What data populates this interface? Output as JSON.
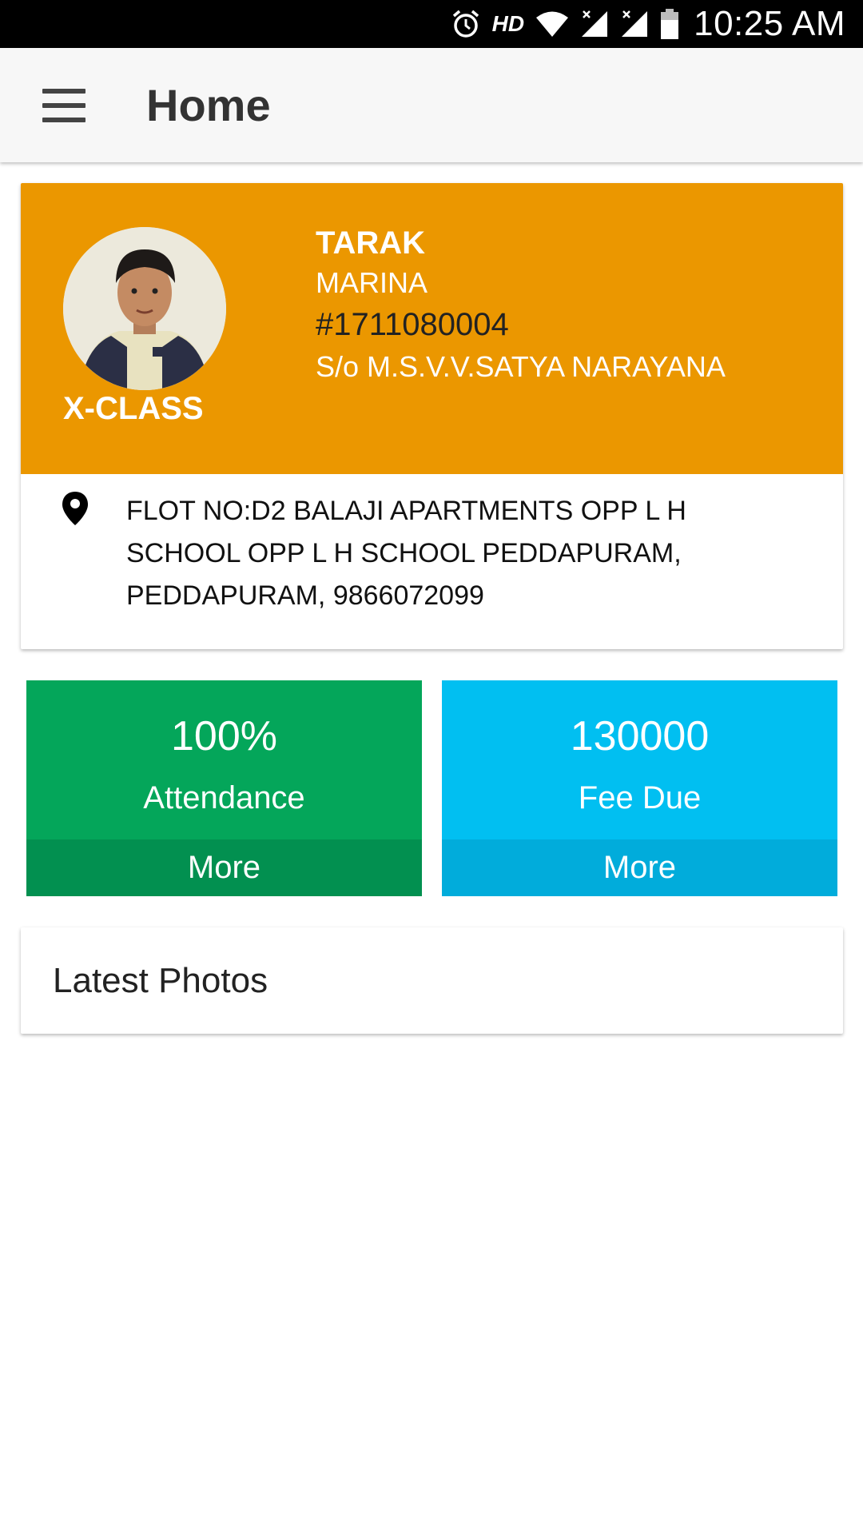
{
  "status_bar": {
    "time": "10:25 AM",
    "hd": "HD",
    "icons": [
      "alarm-icon",
      "wifi-icon",
      "signal-icon",
      "signal-icon",
      "battery-icon"
    ]
  },
  "app_bar": {
    "menu_icon": "menu-icon",
    "title": "Home"
  },
  "profile": {
    "name": "TARAK",
    "school": "MARINA",
    "roll_no": "#1711080004",
    "parent": "S/o M.S.V.V.SATYA NARAYANA",
    "class": "X-CLASS",
    "address_icon": "location-pin-icon",
    "address": "FLOT NO:D2 BALAJI APARTMENTS OPP L H\nSCHOOL OPP L H SCHOOL PEDDAPURAM,\n PEDDAPURAM,  9866072099"
  },
  "tiles": [
    {
      "value": "100%",
      "label": "Attendance",
      "more": "More",
      "color": "#04a65a"
    },
    {
      "value": "130000",
      "label": "Fee Due",
      "more": "More",
      "color": "#01bff1"
    }
  ],
  "latest_photos": {
    "title": "Latest Photos"
  },
  "colors": {
    "profile_header": "#eb9700",
    "attendance": "#04a65a",
    "fee_due": "#01bff1"
  }
}
